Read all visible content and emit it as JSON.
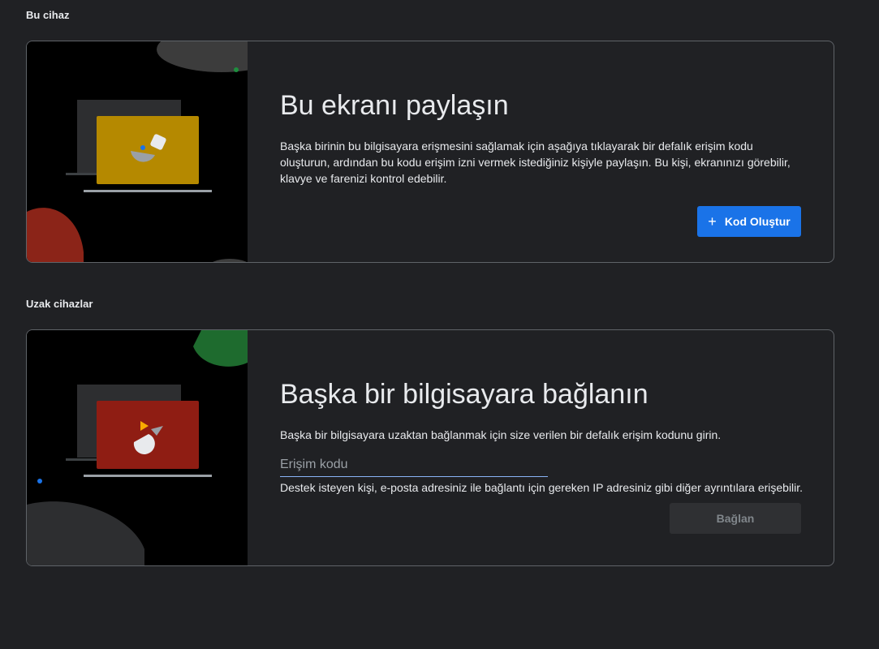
{
  "this_device": {
    "section_title": "Bu cihaz",
    "card_title": "Bu ekranı paylaşın",
    "description": "Başka birinin bu bilgisayara erişmesini sağlamak için aşağıya tıklayarak bir defalık erişim kodu oluşturun, ardından bu kodu erişim izni vermek istediğiniz kişiyle paylaşın. Bu kişi, ekranınızı görebilir, klavye ve farenizi kontrol edebilir.",
    "button_label": "Kod Oluştur",
    "button_icon": "plus-icon"
  },
  "remote_devices": {
    "section_title": "Uzak cihazlar",
    "card_title": "Başka bir bilgisayara bağlanın",
    "description": "Başka bir bilgisayara uzaktan bağlanmak için size verilen bir defalık erişim kodunu girin.",
    "input_placeholder": "Erişim kodu",
    "input_value": "",
    "helper_text": "Destek isteyen kişi, e-posta adresiniz ile bağlantı için gereken IP adresiniz gibi diğer ayrıntılara erişebilir.",
    "button_label": "Bağlan"
  },
  "colors": {
    "background": "#202124",
    "accent": "#1a73e8",
    "illus_share_screen": "#b58900",
    "illus_connect_screen": "#8f1d13",
    "illus_red_blob": "#8b2418",
    "illus_green_blob": "#1e6b2e"
  }
}
